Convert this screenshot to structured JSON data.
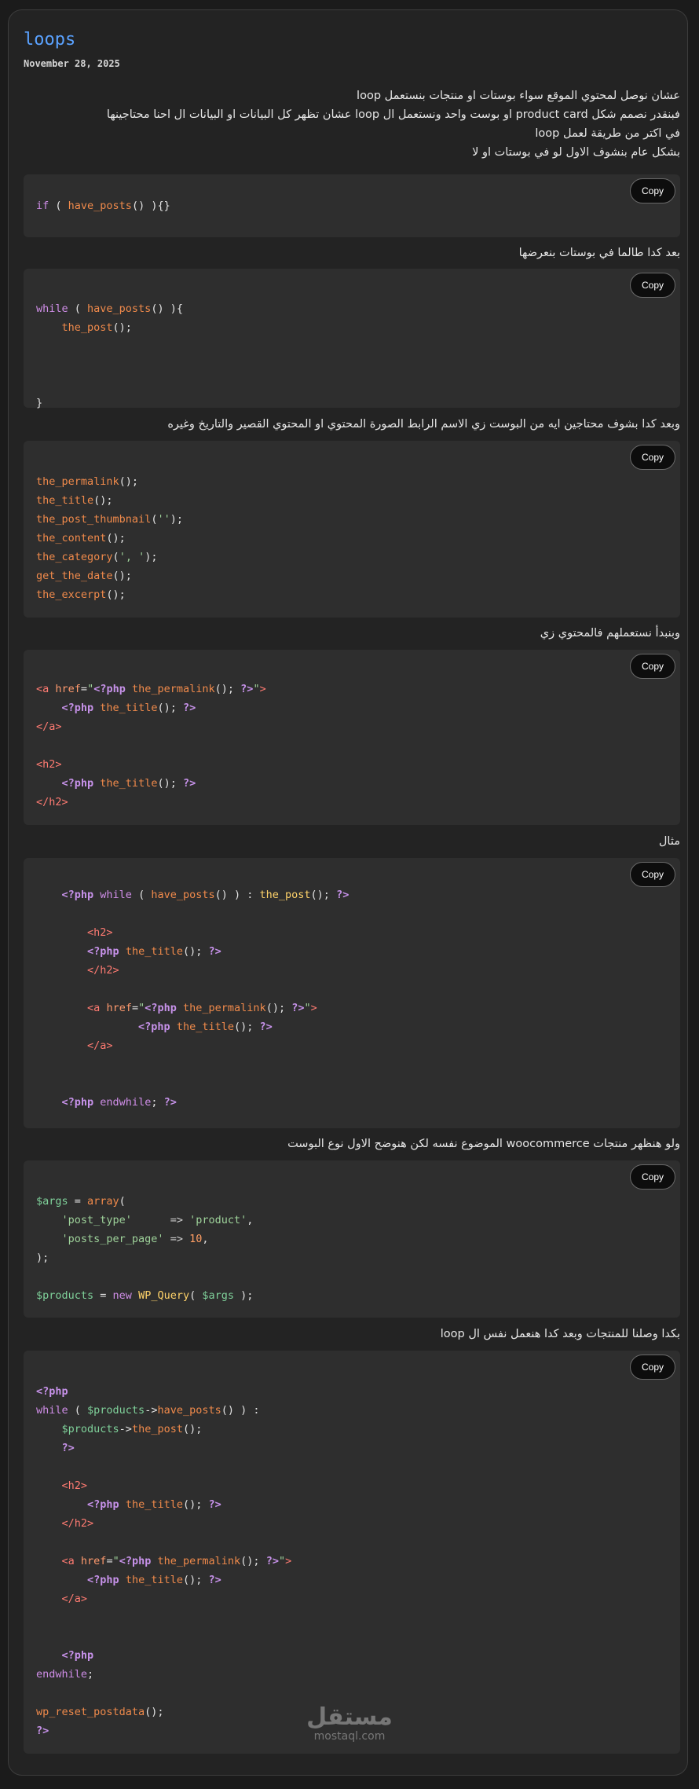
{
  "post": {
    "title": "loops",
    "date": "November 28, 2025"
  },
  "intro": {
    "line1": "عشان نوصل لمحتوي الموقع سواء بوستات او منتجات بنستعمل loop",
    "line2": "فبنقدر نصمم شكل product card او بوست واحد ونستعمل ال loop عشان تظهر كل البيانات او البيانات ال احنا محتاجينها",
    "line3": "في اكتر من طريقة لعمل loop",
    "line4": "بشكل عام بنشوف الاول لو في بوستات او لا"
  },
  "copy_label": "Copy",
  "para2": "بعد كدا طالما في بوستات بنعرضها",
  "para3": "وبعد كدا بشوف محتاجين ايه من البوست زي الاسم الرابط الصورة المحتوي او المحتوي القصير والتاريخ وغيره",
  "para4": "وبنبدأ نستعملهم فالمحتوي زي",
  "para5": "مثال",
  "para6": "ولو هنظهر منتجات woocommerce الموضوع نفسه لكن هنوضح الاول نوع البوست",
  "para7": "بكدا وصلنا للمنتجات وبعد كدا هنعمل نفس ال loop",
  "watermark": {
    "arabic": "مستقل",
    "latin": "mostaql.com"
  }
}
